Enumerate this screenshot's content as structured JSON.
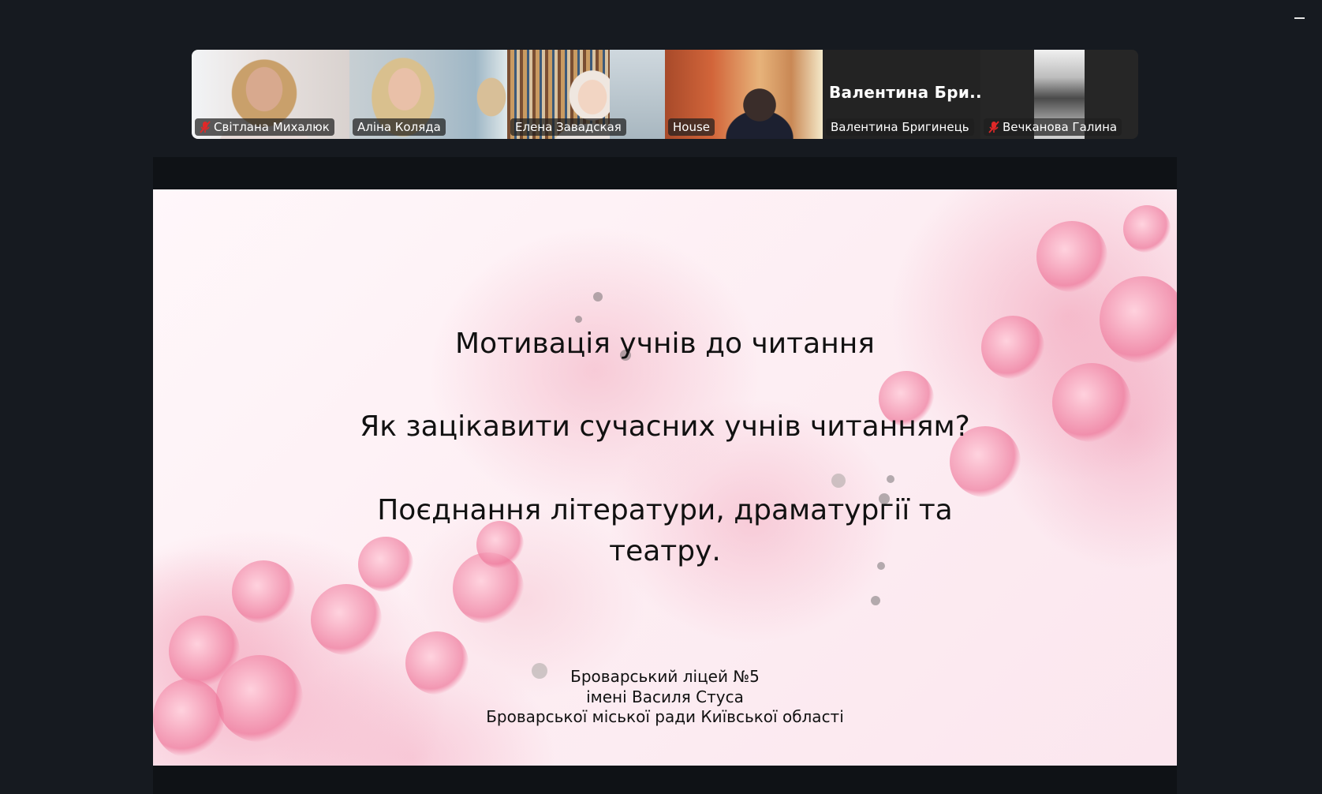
{
  "window": {
    "minimize_label": "minimize"
  },
  "participants": [
    {
      "name": "Світлана Михалюк",
      "muted": true,
      "speaking": false
    },
    {
      "name": "Аліна Коляда",
      "muted": false,
      "speaking": true
    },
    {
      "name": "Елена Завадская",
      "muted": false,
      "speaking": false
    },
    {
      "name": "House",
      "muted": false,
      "speaking": false
    },
    {
      "name": "Валентина Бригинець",
      "muted": false,
      "speaking": false,
      "display_name_large": "Валентина  Бри..."
    },
    {
      "name": "Вечканова Галина",
      "muted": true,
      "speaking": false
    }
  ],
  "slide": {
    "line1": "Мотивація учнів до читання",
    "line2": "Як зацікавити сучасних учнів читанням?",
    "line3a": "Поєднання літератури, драматургії та",
    "line3b": "театру.",
    "footer1": "Броварський ліцей №5",
    "footer2": "імені Василя Стуса",
    "footer3": "Броварської міської ради Київської області"
  },
  "colors": {
    "background": "#161a20",
    "speaking_border": "#23d959",
    "mute_red": "#e02828"
  }
}
